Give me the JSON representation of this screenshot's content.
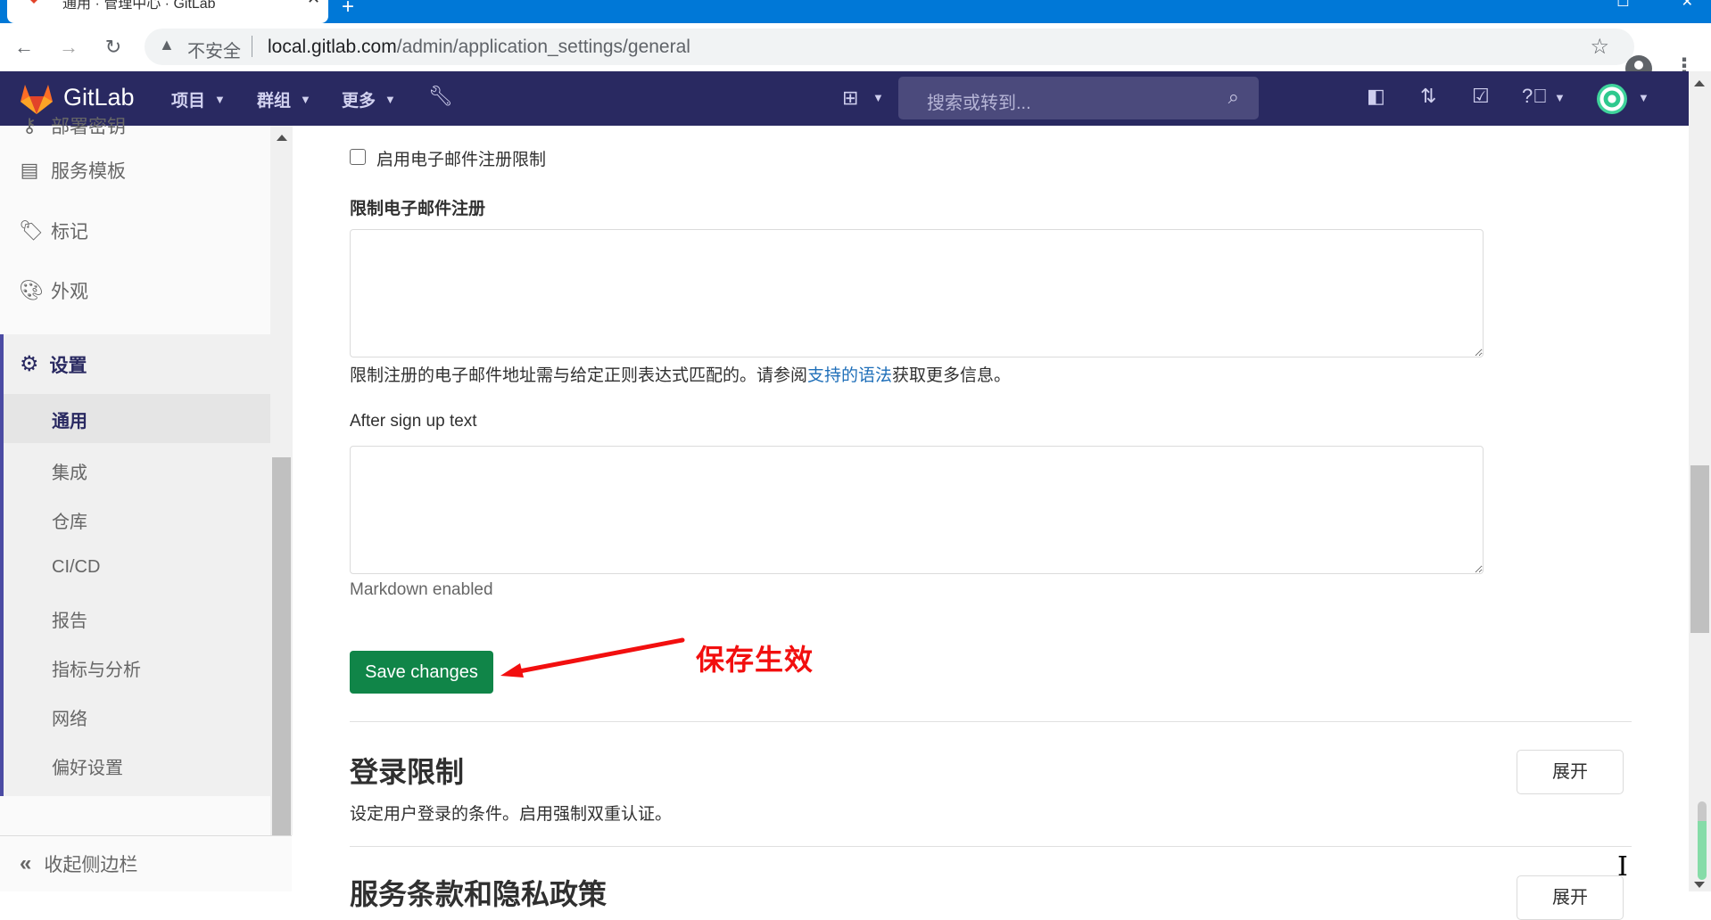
{
  "browser": {
    "tab_title": "通用 · 管理中心 · GitLab",
    "new_tab": "+",
    "insecure_label": "不安全",
    "url_host": "local.gitlab.com",
    "url_path": "/admin/application_settings/general"
  },
  "header": {
    "brand": "GitLab",
    "nav": [
      {
        "label": "项目"
      },
      {
        "label": "群组"
      },
      {
        "label": "更多"
      }
    ],
    "search_placeholder": "搜索或转到..."
  },
  "sidebar": {
    "items": [
      {
        "label": "部署密钥",
        "icon": "key-icon"
      },
      {
        "label": "服务模板",
        "icon": "template-icon"
      },
      {
        "label": "标记",
        "icon": "label-icon"
      },
      {
        "label": "外观",
        "icon": "appearance-icon"
      }
    ],
    "settings": {
      "label": "设置",
      "sub_items": [
        "通用",
        "集成",
        "仓库",
        "CI/CD",
        "报告",
        "指标与分析",
        "网络",
        "偏好设置"
      ],
      "active": "通用"
    },
    "collapse_label": "收起侧边栏"
  },
  "main": {
    "checkbox_label": "启用电子邮件注册限制",
    "checkbox_checked": false,
    "restrict_label": "限制电子邮件注册",
    "restrict_value": "",
    "restrict_help_before": "限制注册的电子邮件地址需与给定正则表达式匹配的。请参阅",
    "restrict_help_link": "支持的语法",
    "restrict_help_after": "获取更多信息。",
    "after_signup_label": "After sign up text",
    "after_signup_value": "",
    "markdown_hint": "Markdown enabled",
    "save_label": "Save changes",
    "annotation": "保存生效",
    "sections": [
      {
        "title": "登录限制",
        "description": "设定用户登录的条件。启用强制双重认证。",
        "button": "展开"
      },
      {
        "title": "服务条款和隐私政策",
        "description": "",
        "button": "展开"
      }
    ]
  },
  "colors": {
    "header_bg": "#292961",
    "save_button": "#108548",
    "annotation": "#f20f0f",
    "link": "#1f6fb9"
  }
}
